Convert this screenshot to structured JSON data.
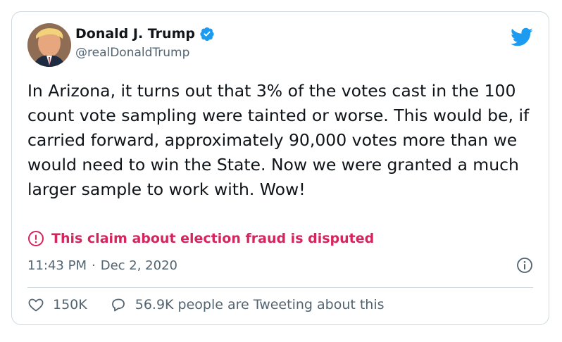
{
  "author": {
    "name": "Donald J. Trump",
    "handle": "@realDonaldTrump",
    "verified": true,
    "avatar_icon": "avatar-portrait"
  },
  "tweet": {
    "text": "In Arizona, it turns out that 3% of the votes cast in the 100 count vote sampling were tainted or worse. This would be, if carried forward, approximately 90,000 votes more than we would need to win the State. Now we were granted a much larger sample to work with. Wow!"
  },
  "label": {
    "text": "This claim about election fraud is disputed",
    "icon": "exclamation-circle-icon",
    "color": "#d6245c"
  },
  "meta": {
    "time": "11:43 PM",
    "separator": "·",
    "date": "Dec 2, 2020"
  },
  "actions": {
    "likes": "150K",
    "tweeting": "56.9K people are Tweeting about this"
  },
  "colors": {
    "brand": "#1d9bf0",
    "text_secondary": "#536471",
    "border": "#cfd9de"
  }
}
